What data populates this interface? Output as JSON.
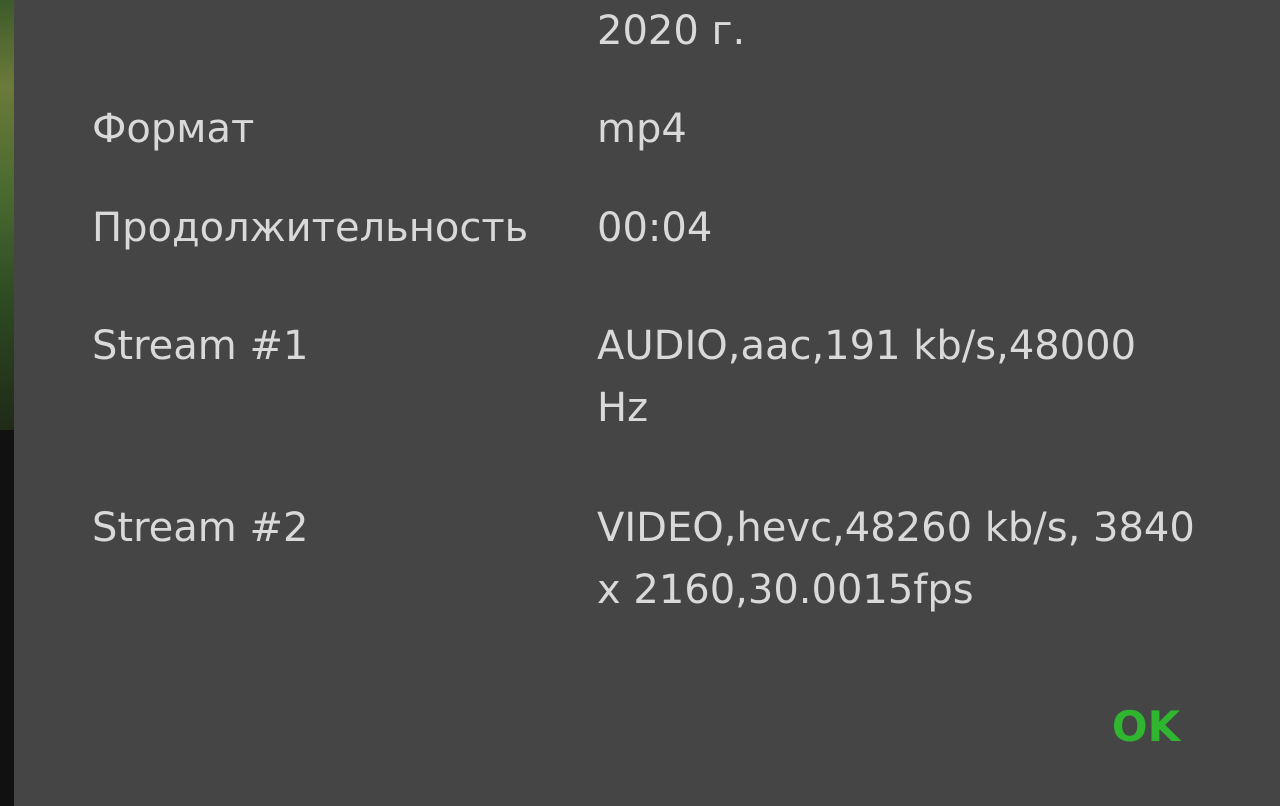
{
  "dialog": {
    "rows": [
      {
        "label": "",
        "value": "2020 г."
      },
      {
        "label": "Формат",
        "value": "mp4"
      },
      {
        "label": "Продолжительность",
        "value": "00:04"
      },
      {
        "label": "Stream #1",
        "value": "AUDIO,aac,191 kb/s,48000 Hz"
      },
      {
        "label": "Stream #2",
        "value": "VIDEO,hevc,48260 kb/s, 3840 x 2160,30.0015fps"
      }
    ],
    "ok_label": "OK"
  },
  "colors": {
    "dialog_bg": "#454545",
    "text": "#d9d9d9",
    "accent": "#2fb52f"
  }
}
